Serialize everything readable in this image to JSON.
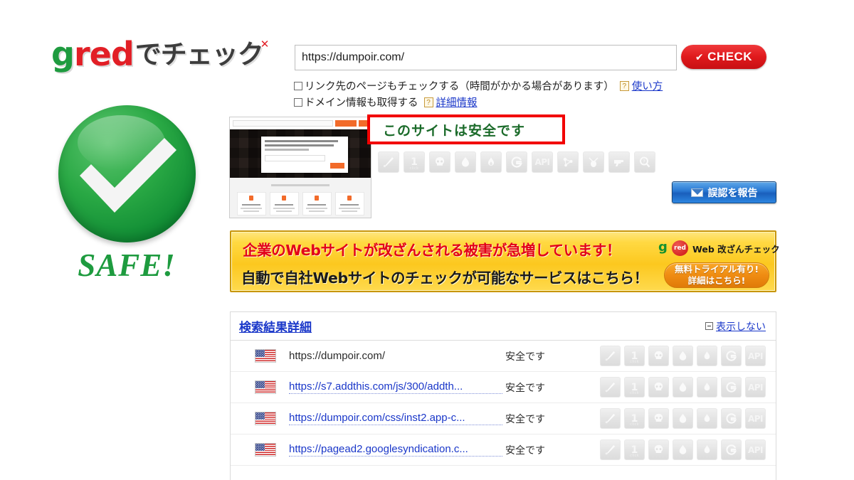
{
  "logo": {
    "g": "g",
    "red": "red",
    "jp": "でチェック",
    "alt": "gred でチェック"
  },
  "search": {
    "url_value": "https://dumpoir.com/",
    "url_placeholder": "https://",
    "check_label": "CHECK",
    "check_tick": "✔"
  },
  "options": [
    {
      "label": "リンク先のページもチェックする（時間がかかる場合があります）",
      "help_icon": "?",
      "link": "使い方",
      "checked": false
    },
    {
      "label": "ドメイン情報も取得する",
      "help_icon": "?",
      "link": "詳細情報",
      "checked": false
    }
  ],
  "verdict": {
    "badge_text": "SAFE!",
    "banner_text": "このサイトは安全です",
    "banner_border_color": "#f20000",
    "badge_color": "#1e9b3f"
  },
  "top_icons": [
    {
      "name": "malware-icon",
      "label": ""
    },
    {
      "name": "one-click-icon",
      "label": "1",
      "sub": "click"
    },
    {
      "name": "skull-icon",
      "label": ""
    },
    {
      "name": "droplet-icon",
      "label": ""
    },
    {
      "name": "flame-icon",
      "label": ""
    },
    {
      "name": "g-spiral-icon",
      "label": "G"
    },
    {
      "name": "api-icon",
      "label": "API"
    },
    {
      "name": "network-icon",
      "label": ""
    },
    {
      "name": "phishing-icon",
      "label": ""
    },
    {
      "name": "gun-icon",
      "label": ""
    },
    {
      "name": "magnifier-question-icon",
      "label": "?"
    }
  ],
  "report_button": {
    "label": "誤認を報告",
    "icon": "envelope-icon"
  },
  "ad": {
    "line1": "企業のWebサイトが改ざんされる被害が急増しています！",
    "line2": "自動で自社Webサイトのチェックが可能なサービスはこちら！",
    "logo_g": "g",
    "logo_red": "red",
    "logo_text": "Web 改ざんチェック",
    "cta_line1": "無料トライアル有り!",
    "cta_line2": "詳細はこちら!",
    "bg_color": "#ffd942",
    "line1_color": "#e2001a"
  },
  "results": {
    "title": "検索結果詳細",
    "hide_label": "表示しない",
    "row_icons": [
      "malware-icon",
      "one-click-icon",
      "skull-icon",
      "droplet-icon",
      "flame-icon",
      "g-spiral-icon",
      "api-icon"
    ],
    "rows": [
      {
        "flag": "us-flag",
        "url": "https://dumpoir.com/",
        "is_link": false,
        "status": "安全です"
      },
      {
        "flag": "us-flag",
        "url": "https://s7.addthis.com/js/300/addth...",
        "is_link": true,
        "status": "安全です"
      },
      {
        "flag": "us-flag",
        "url": "https://dumpoir.com/css/inst2.app-c...",
        "is_link": true,
        "status": "安全です"
      },
      {
        "flag": "us-flag",
        "url": "https://pagead2.googlesyndication.c...",
        "is_link": true,
        "status": "安全です"
      }
    ]
  }
}
